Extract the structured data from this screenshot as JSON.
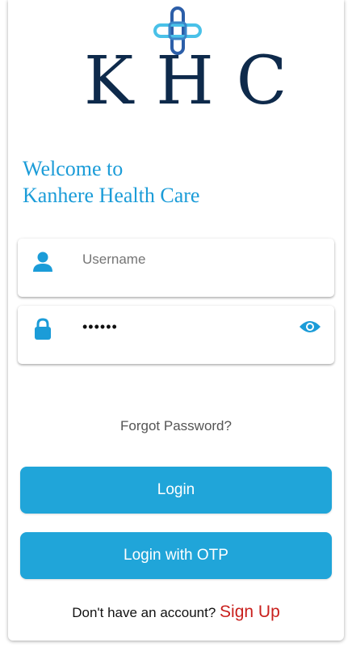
{
  "logo": {
    "text": "KHC",
    "icon": "khc-cross-logo-icon",
    "colors": {
      "light": "#49c1e8",
      "dark": "#2c5ea8",
      "text": "#0e2a4b"
    }
  },
  "welcome": {
    "line1": "Welcome to",
    "line2": "Kanhere Health Care"
  },
  "username": {
    "icon": "person-icon",
    "placeholder": "Username",
    "value": ""
  },
  "password": {
    "icon": "lock-icon",
    "value": "••••••",
    "toggle_icon": "eye-icon"
  },
  "forgot_password": "Forgot Password?",
  "buttons": {
    "login": "Login",
    "login_otp": "Login with OTP"
  },
  "signup": {
    "prompt": "Don't have an account?",
    "link": "Sign Up"
  },
  "colors": {
    "accent": "#20a5d9",
    "icon": "#1b9cd8",
    "signup": "#c9201d"
  }
}
